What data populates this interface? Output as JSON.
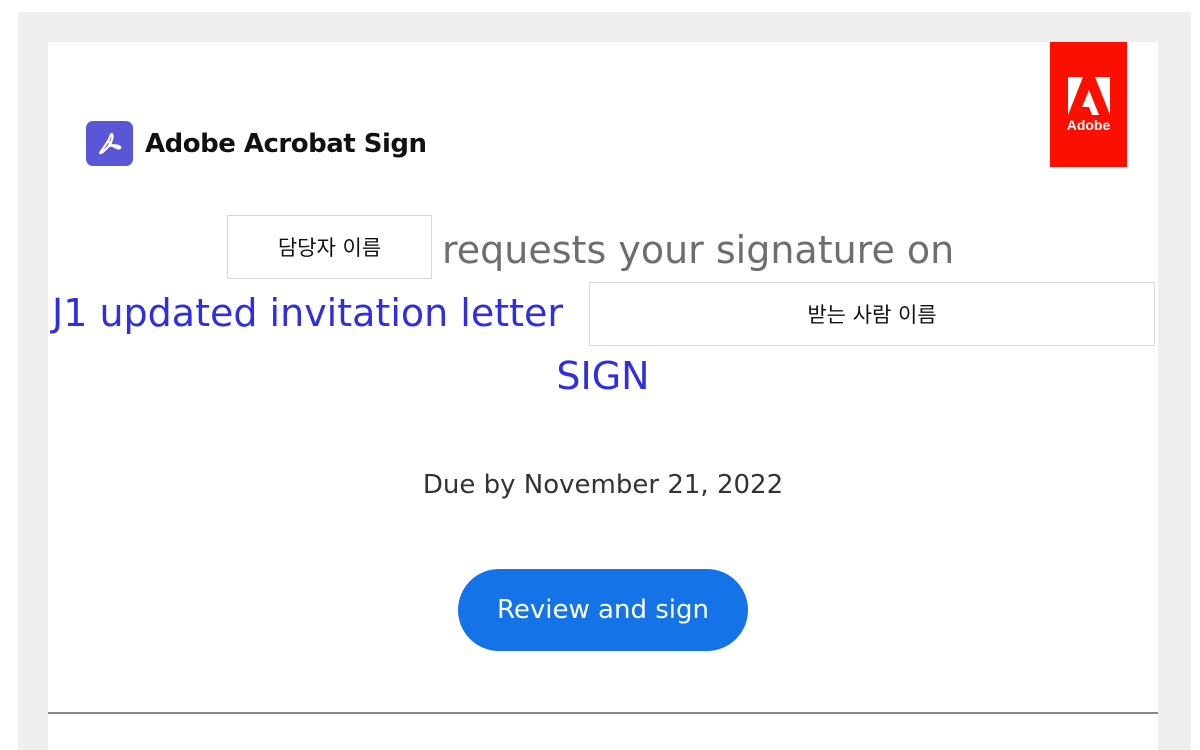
{
  "header": {
    "product_name": "Adobe Acrobat Sign",
    "product_icon": "acrobat-pdf-icon",
    "adobe_logo_text": "Adobe",
    "adobe_logo_icon": "adobe-a-icon",
    "colors": {
      "product_tile": "#5a57d6",
      "adobe_badge": "#fa0f00"
    }
  },
  "message": {
    "sender_name": "담당자 이름",
    "request_text": "requests your signature on",
    "document_name": "J1 updated invitation letter",
    "recipient_name": "받는 사람 이름",
    "document_suffix": "SIGN",
    "due_text": "Due by November 21, 2022",
    "colors": {
      "document_link": "#2f2fe0",
      "request_text": "#6e6e6e"
    }
  },
  "cta": {
    "label": "Review and sign",
    "color": "#1473e6"
  }
}
